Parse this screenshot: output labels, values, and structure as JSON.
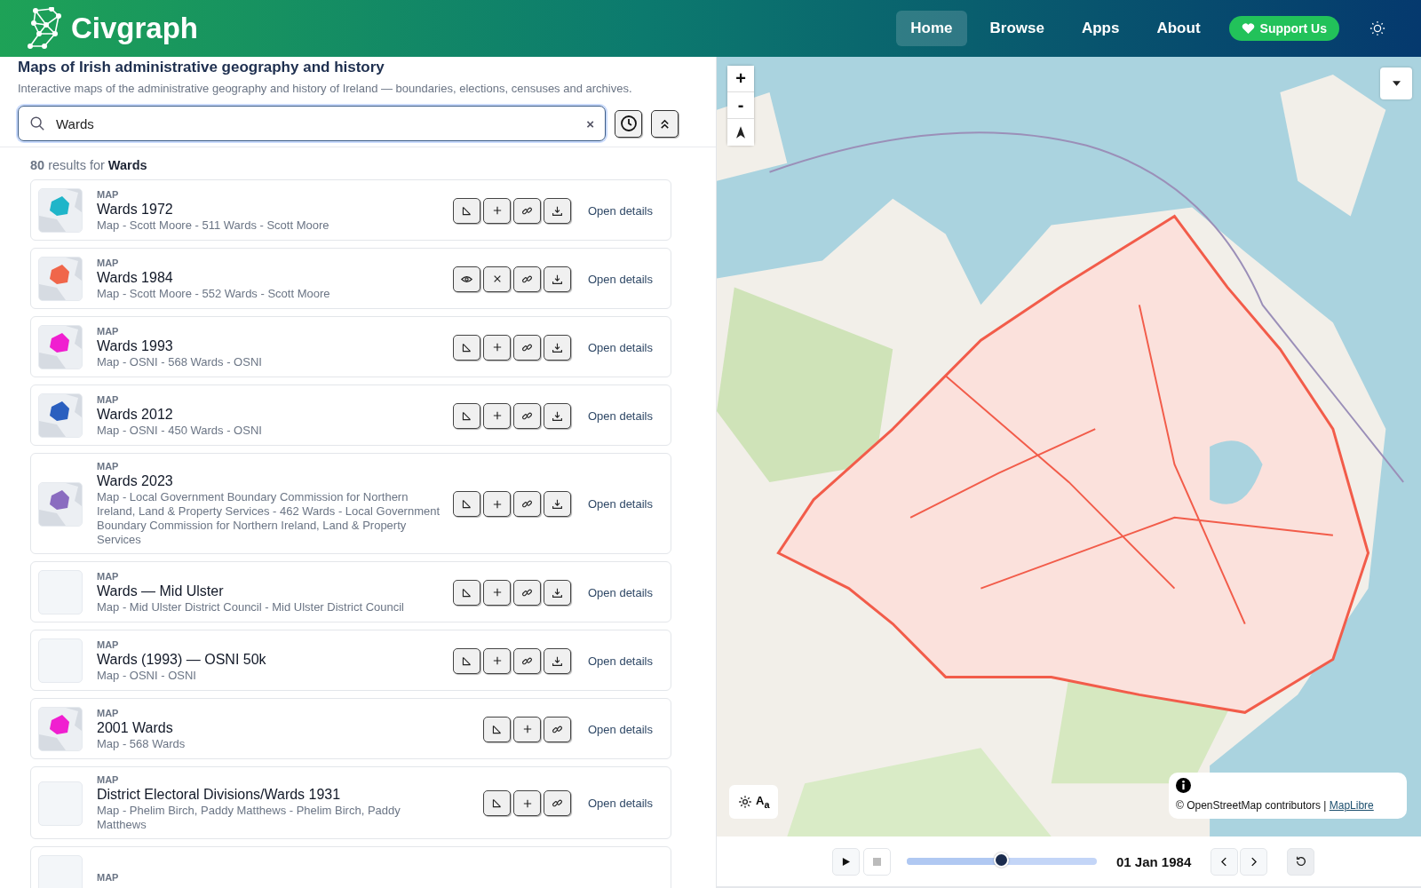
{
  "header": {
    "brand": "Civgraph",
    "nav": [
      {
        "label": "Home",
        "selected": true
      },
      {
        "label": "Browse",
        "selected": false
      },
      {
        "label": "Apps",
        "selected": false
      },
      {
        "label": "About",
        "selected": false
      }
    ],
    "support": "Support Us"
  },
  "intro": {
    "title": "Maps of Irish administrative geography and history",
    "subtitle": "Interactive maps of the administrative geography and history of Ireland — boundaries, elections, censuses and archives."
  },
  "search": {
    "value": "Wards",
    "clear": "×"
  },
  "results": {
    "count": "80",
    "label": "results for",
    "query": "Wards"
  },
  "items": [
    {
      "type": "MAP",
      "title": "Wards 1972",
      "meta": "Map - Scott Moore - 511 Wards - Scott Moore",
      "color": "#1fb5c9",
      "on_map": false,
      "download": true,
      "action": "Open details"
    },
    {
      "type": "MAP",
      "title": "Wards 1984",
      "meta": "Map - Scott Moore - 552 Wards - Scott Moore",
      "color": "#f0664a",
      "on_map": true,
      "download": true,
      "action": "Open details"
    },
    {
      "type": "MAP",
      "title": "Wards 1993",
      "meta": "Map - OSNI - 568 Wards - OSNI",
      "color": "#f01fd0",
      "on_map": false,
      "download": true,
      "action": "Open details"
    },
    {
      "type": "MAP",
      "title": "Wards 2012",
      "meta": "Map - OSNI - 450 Wards - OSNI",
      "color": "#2a5fbf",
      "on_map": false,
      "download": true,
      "action": "Open details"
    },
    {
      "type": "MAP",
      "title": "Wards 2023",
      "meta": "Map - Local Government Boundary Commission for Northern Ireland, Land & Property Services - 462 Wards - Local Government Boundary Commission for Northern Ireland, Land & Property Services",
      "color": "#8a6cc0",
      "on_map": false,
      "download": true,
      "action": "Open details"
    },
    {
      "type": "MAP",
      "title": "Wards — Mid Ulster",
      "meta": "Map - Mid Ulster District Council - Mid Ulster District Council",
      "on_map": false,
      "download": true,
      "action": "Open details"
    },
    {
      "type": "MAP",
      "title": "Wards (1993) — OSNI 50k",
      "meta": "Map - OSNI - OSNI",
      "on_map": false,
      "download": true,
      "action": "Open details"
    },
    {
      "type": "MAP",
      "title": "2001 Wards",
      "meta": "Map - 568 Wards",
      "color": "#f01fd0",
      "on_map": false,
      "download": false,
      "action": "Open details"
    },
    {
      "type": "MAP",
      "title": "District Electoral Divisions/Wards 1931",
      "meta": "Map - Phelim Birch, Paddy Matthews - Phelim Birch, Paddy Matthews",
      "on_map": false,
      "download": false,
      "action": "Open details"
    },
    {
      "type": "MAP"
    }
  ],
  "map": {
    "zoom_in": "+",
    "zoom_out": "-",
    "style_label": "A$_{a}$",
    "attribution": "© OpenStreetMap contributors |",
    "attribution_link": "MapLibre"
  },
  "timeline": {
    "level": 0.5,
    "date": "01 Jan 1984"
  }
}
